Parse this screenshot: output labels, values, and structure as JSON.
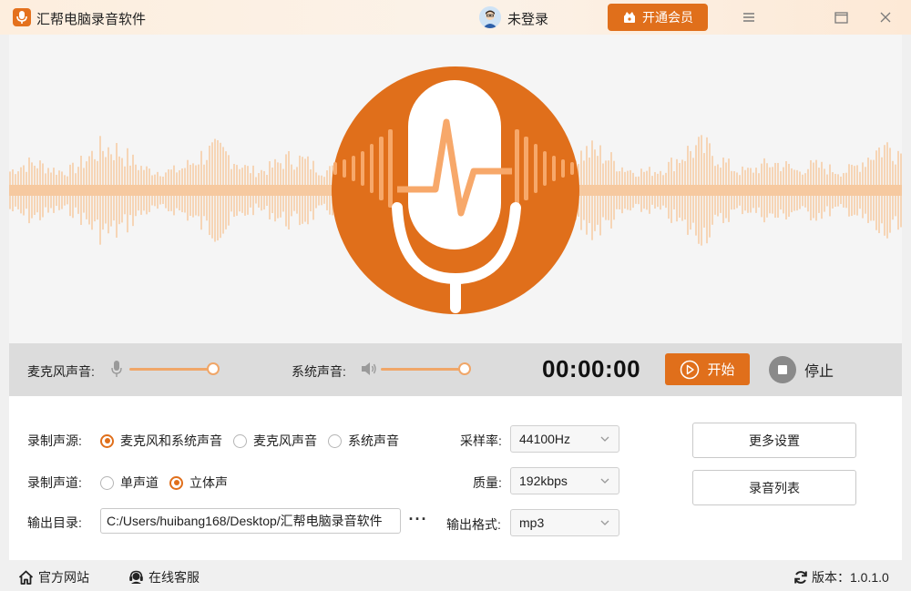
{
  "app": {
    "title": "汇帮电脑录音软件"
  },
  "header": {
    "login_text": "未登录",
    "vip_label": "开通会员"
  },
  "controls": {
    "mic_volume_label": "麦克风声音:",
    "mic_volume": 0.84,
    "system_volume_label": "系统声音:",
    "system_volume": 0.84,
    "timer": "00:00:00",
    "start_label": "开始",
    "stop_label": "停止"
  },
  "settings": {
    "source": {
      "label": "录制声源:",
      "options": [
        "麦克风和系统声音",
        "麦克风声音",
        "系统声音"
      ],
      "selected": "麦克风和系统声音"
    },
    "channel": {
      "label": "录制声道:",
      "options": [
        "单声道",
        "立体声"
      ],
      "selected": "立体声"
    },
    "output_dir": {
      "label": "输出目录:",
      "value": "C:/Users/huibang168/Desktop/汇帮电脑录音软件"
    },
    "sample_rate": {
      "label": "采样率:",
      "value": "44100Hz"
    },
    "quality": {
      "label": "质量:",
      "value": "192kbps"
    },
    "format": {
      "label": "输出格式:",
      "value": "mp3"
    },
    "more_settings_label": "更多设置",
    "record_list_label": "录音列表"
  },
  "footer": {
    "website_label": "官方网站",
    "support_label": "在线客服",
    "version_text": "版本：1.0.1.0"
  },
  "colors": {
    "accent": "#e06f1b",
    "wave": "#f6c9a0",
    "slider": "#f0a668"
  },
  "icons": {
    "logo": "microphone-logo-icon",
    "avatar": "user-avatar-icon",
    "vip": "crown-gift-icon",
    "menu": "hamburger-menu-icon",
    "maximize": "maximize-icon",
    "close": "close-icon",
    "mic": "microphone-icon",
    "speaker": "speaker-icon",
    "play": "play-circle-icon",
    "stop": "stop-icon",
    "home": "home-icon",
    "support": "headset-icon",
    "refresh": "refresh-icon"
  }
}
